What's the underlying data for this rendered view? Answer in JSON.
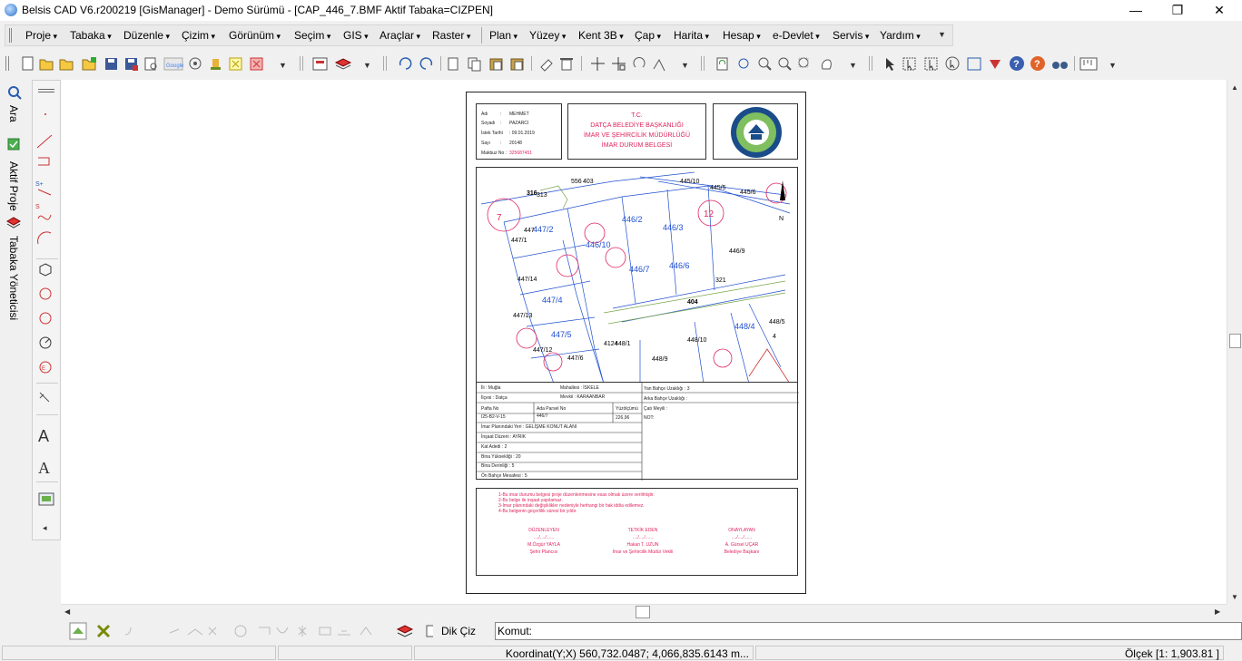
{
  "window": {
    "title": "Belsis CAD V6.r200219 [GisManager] - Demo Sürümü - [CAP_446_7.BMF  Aktif Tabaka=CIZPEN]",
    "minimize_label": "—",
    "restore_label": "❐",
    "close_label": "✕"
  },
  "menubar": {
    "left_items": [
      "Proje",
      "Tabaka",
      "Düzenle",
      "Çizim",
      "Görünüm",
      "Seçim",
      "GIS",
      "Araçlar",
      "Raster"
    ],
    "right_items": [
      "Plan",
      "Yüzey",
      "Kent 3B",
      "Çap",
      "Harita",
      "Hesap",
      "e-Devlet",
      "Servis",
      "Yardım"
    ]
  },
  "left_tabs": [
    "Ara",
    "Aktif Proje",
    "Tabaka Yöneticisi"
  ],
  "document": {
    "info": {
      "rows": [
        {
          "label": "Adı",
          "value": "MEHMET"
        },
        {
          "label": "Soyadı",
          "value": "PAZARCI"
        },
        {
          "label": "İstek Tarihi",
          "value": "09.01.2019"
        },
        {
          "label": "Sayı",
          "value": "20148"
        },
        {
          "label": "Makbuz No",
          "value": "325687451"
        }
      ]
    },
    "header": {
      "line1": "T.C.",
      "line2": "DATÇA BELEDİYE BAŞKANLIĞI",
      "line3": "İMAR VE ŞEHİRCİLİK MÜDÜRLÜĞÜ",
      "line4": "İMAR DURUM BELGESİ"
    },
    "map_labels": [
      "316",
      "313",
      "556",
      "403",
      "445/10",
      "445/5",
      "445/6",
      "447",
      "447/2",
      "447/1",
      "446/2",
      "446/3",
      "446/9",
      "446/10",
      "446/7",
      "446/6",
      "321",
      "447/14",
      "447/4",
      "404",
      "447/13",
      "447/5",
      "448/1",
      "448/10",
      "448/4",
      "448/5",
      "447/12",
      "447/6",
      "448/9",
      "4124",
      "12",
      "7",
      "N",
      "4"
    ],
    "grid": {
      "il_label": "İli",
      "il_value": "Muğla",
      "mahalle_label": "Mahallesi",
      "mahalle_value": "İSKELE",
      "yan_label": "Yan Bahçe Uzaklığı",
      "yan_value": "3",
      "ilce_label": "İlçesi",
      "ilce_value": "Datça",
      "mevkii_label": "Mevkii",
      "mevkii_value": "KARAANBAR",
      "arka_label": "Arka Bahçe Uzaklığı",
      "arka_value": "",
      "pafta_label": "Pafta No",
      "pafta_value": "I25-B2-V-15",
      "ada_label": "Ada Parsel No",
      "ada_value": "446/7",
      "yuz_label": "Yüzölçümü",
      "yuz_value": "226,96",
      "cati_label": "Çatı Meyili",
      "cati_value": "",
      "not_label": "NOT:",
      "rows": [
        {
          "label": "İmar Planındaki Yeri",
          "value": "GELİŞME KONUT ALANI"
        },
        {
          "label": "İnşaat Düzeni",
          "value": "AYRIK"
        },
        {
          "label": "Kat Adedi",
          "value": "2"
        },
        {
          "label": "Bina Yüksekliği",
          "value": "20"
        },
        {
          "label": "Bina Derinliği",
          "value": "5"
        },
        {
          "label": "Ön Bahçe Mesafesi",
          "value": "5"
        }
      ]
    },
    "notes": [
      "1-Bu imar durumu belgesi proje düzenlenmesine esas olmak üzere verilmiştir.",
      "2-Bu belge ile inşaat yapılamaz.",
      "3-İmar planındaki değişiklikler nedeniyle herhangi bir hak iddia edilemez.",
      "4-Bu belgenin geçerlilik süresi bir yıldır."
    ],
    "signatures": [
      {
        "role": "DÜZENLEYEN",
        "date": "..../..../......",
        "name": "M.Özgür YAYLA",
        "title": "Şehir Plancısı"
      },
      {
        "role": "TETKİK EDEN",
        "date": "..../..../......",
        "name": "Hakan T. UZUN",
        "title": "İmar ve Şehircilik Müdür Vekili"
      },
      {
        "role": "ONAYLAYAN",
        "date": "..../..../......",
        "name": "A. Gürsel UÇAR",
        "title": "Belediye Başkanı"
      }
    ]
  },
  "bottombar": {
    "dik_ciz_label": "Dik Çiz",
    "komut_label": "Komut:"
  },
  "statusbar": {
    "coord": "Koordinat(Y;X)  560,732.0487; 4,066,835.6143 m...",
    "scale": "Ölçek [1: 1,903.81 ]"
  },
  "colors": {
    "accent_red": "#e0245e",
    "map_blue": "#2050d0",
    "seal_blue": "#1a4c8a"
  }
}
